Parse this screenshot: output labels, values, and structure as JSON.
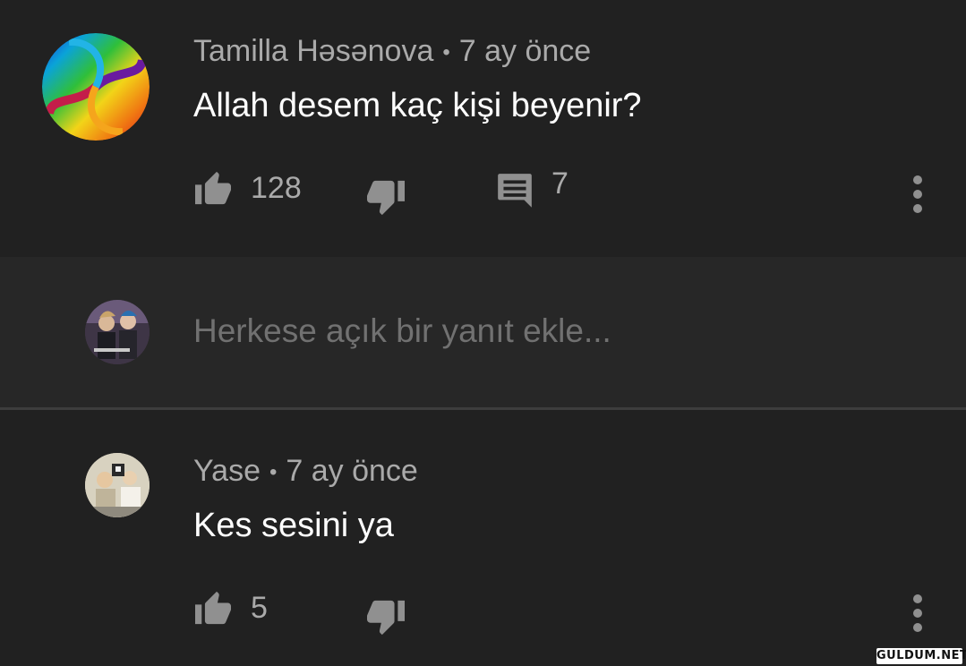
{
  "comments": [
    {
      "author": "Tamilla Həsənova",
      "separator": "•",
      "time": "7 ay önce",
      "text": "Allah desem kaç kişi beyenir?",
      "likes": "128",
      "replies": "7",
      "avatar": "rainbow-spiral"
    },
    {
      "author": "Yase",
      "separator": "•",
      "time": "7 ay önce",
      "text": "Kes sesini ya",
      "likes": "5",
      "avatar": "photo-group"
    }
  ],
  "reply_box": {
    "placeholder": "Herkese açık bir yanıt ekle...",
    "avatar": "band-photo"
  },
  "icons": {
    "like": "thumbs-up-icon",
    "dislike": "thumbs-down-icon",
    "reply": "comment-icon",
    "more": "more-vert-icon"
  },
  "colors": {
    "background": "#212121",
    "reply_row": "#272727",
    "meta_text": "#aaaaaa",
    "icon": "#909090",
    "placeholder": "#717171"
  },
  "watermark": "GULDUM.NET"
}
